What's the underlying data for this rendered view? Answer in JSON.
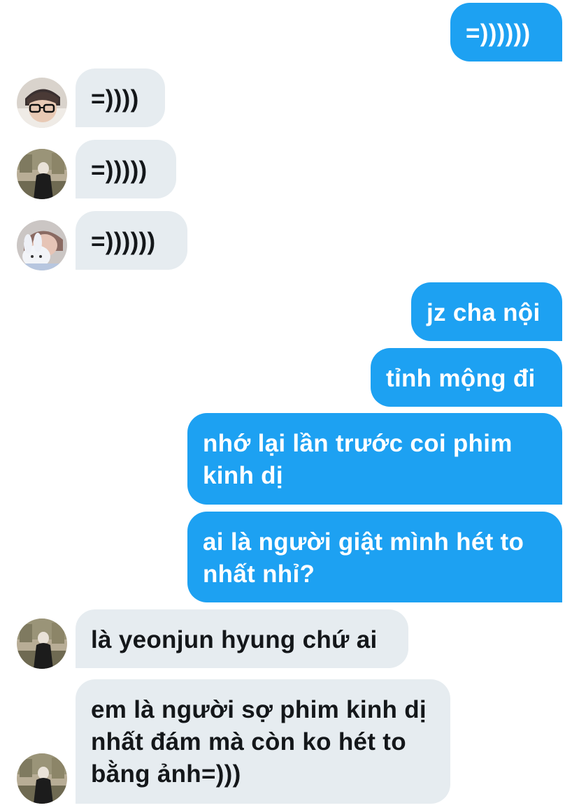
{
  "thread": {
    "messages": [
      {
        "id": "m1",
        "side": "out",
        "text": "=))))))"
      },
      {
        "id": "m2",
        "side": "in",
        "avatar": "avatar-glasses",
        "text": "=))))"
      },
      {
        "id": "m3",
        "side": "in",
        "avatar": "avatar-garden",
        "text": "=)))))"
      },
      {
        "id": "m4",
        "side": "in",
        "avatar": "avatar-plush",
        "text": "=))))))"
      },
      {
        "id": "m5",
        "side": "out",
        "text": "jz cha nội"
      },
      {
        "id": "m6",
        "side": "out",
        "text": "tỉnh mộng đi"
      },
      {
        "id": "m7",
        "side": "out",
        "text": "nhớ lại lần trước coi phim kinh dị"
      },
      {
        "id": "m8",
        "side": "out",
        "text": "ai là người giật mình hét to nhất nhỉ?"
      },
      {
        "id": "m9",
        "side": "in",
        "avatar": "avatar-garden",
        "text": "là yeonjun hyung chứ ai"
      },
      {
        "id": "m10",
        "side": "in",
        "avatar": "avatar-garden",
        "text": "em là người sợ phim kinh dị nhất đám mà còn ko hét to bằng ảnh=)))"
      }
    ]
  },
  "colors": {
    "outgoing_bubble": "#1da1f2",
    "incoming_bubble": "#e6ecf0",
    "outgoing_text": "#ffffff",
    "incoming_text": "#14171a"
  }
}
